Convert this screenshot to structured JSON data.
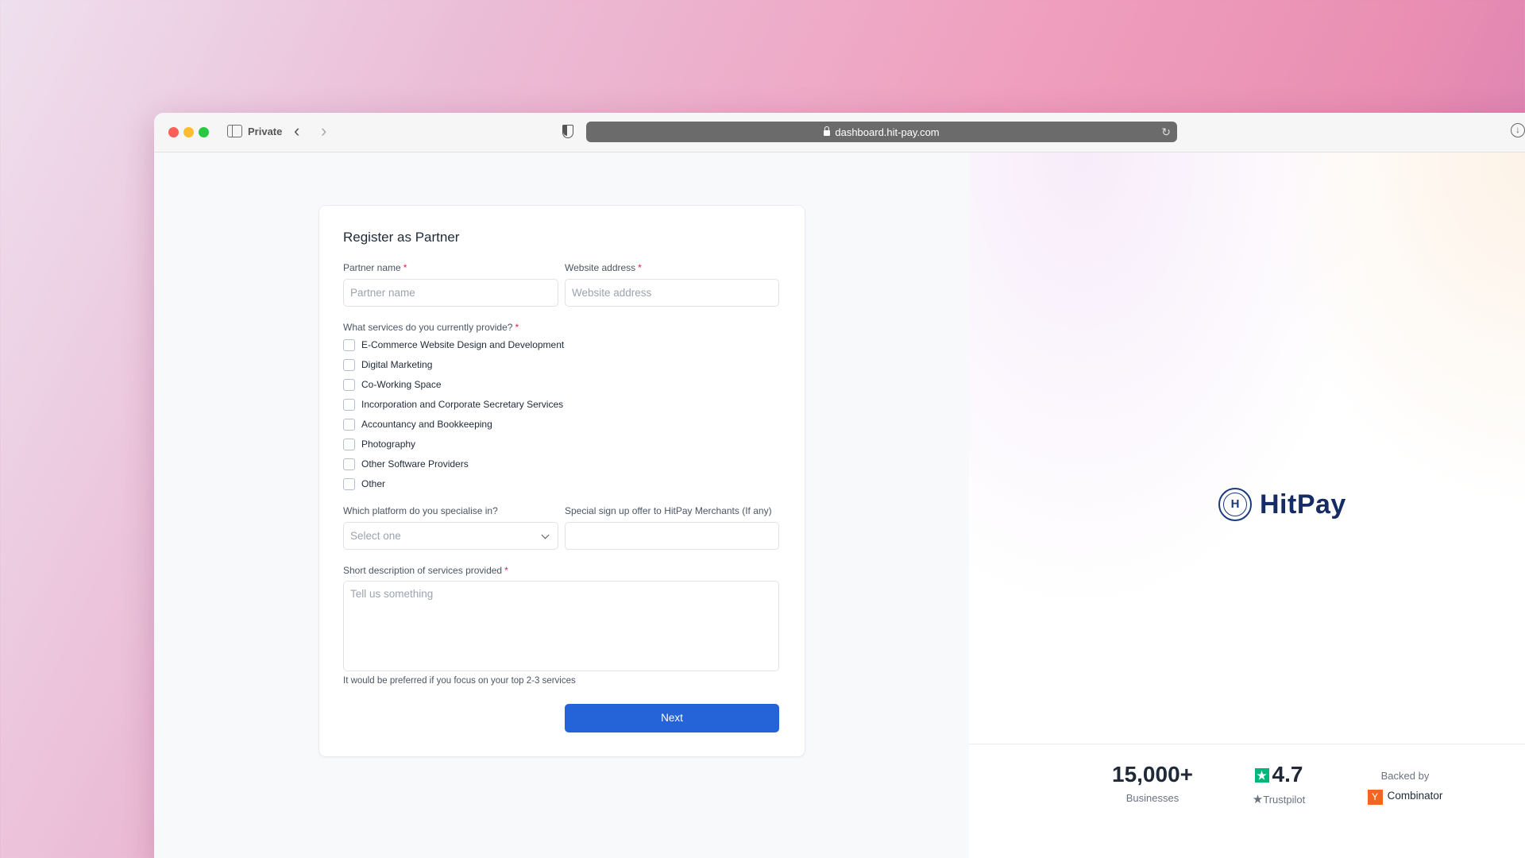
{
  "browser": {
    "private_label": "Private",
    "url": "dashboard.hit-pay.com"
  },
  "form": {
    "title": "Register as Partner",
    "partner_name": {
      "label": "Partner name",
      "placeholder": "Partner name"
    },
    "website": {
      "label": "Website address",
      "placeholder": "Website address"
    },
    "services_label": "What services do you currently provide?",
    "services": [
      "E-Commerce Website Design and Development",
      "Digital Marketing",
      "Co-Working Space",
      "Incorporation and Corporate Secretary Services",
      "Accountancy and Bookkeeping",
      "Photography",
      "Other Software Providers",
      "Other"
    ],
    "platform": {
      "label": "Which platform do you specialise in?",
      "selected": "Select one"
    },
    "offer": {
      "label": "Special sign up offer to HitPay Merchants (If any)",
      "value": ""
    },
    "description": {
      "label": "Short description of services provided",
      "placeholder": "Tell us something"
    },
    "hint": "It would be preferred if you focus on your top 2-3 services",
    "next_label": "Next",
    "required_mark": "*"
  },
  "brand": {
    "logo_letter": "H",
    "name": "HitPay"
  },
  "stats": {
    "businesses_value": "15,000+",
    "businesses_label": "Businesses",
    "rating_value": "4.7",
    "rating_label": "Trustpilot",
    "backed_label": "Backed by",
    "backer_name": "Combinator",
    "backer_mark": "Y"
  },
  "colors": {
    "primary_button": "#2563d9",
    "brand_navy": "#152d64",
    "trustpilot_green": "#00b67a",
    "yc_orange": "#f26522",
    "required": "#e11d48"
  }
}
